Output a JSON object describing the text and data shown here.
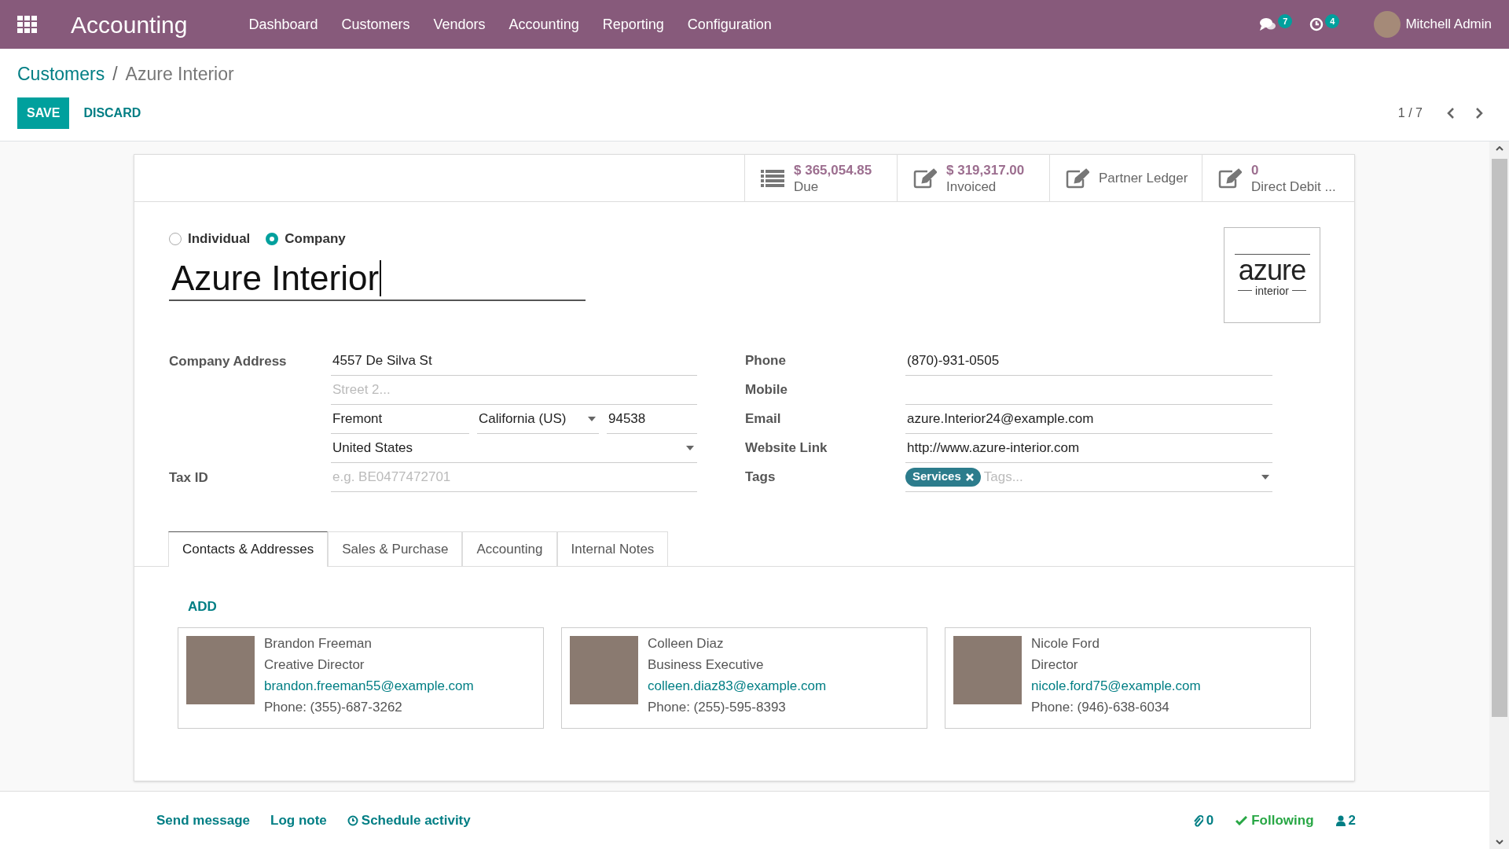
{
  "topbar": {
    "app": "Accounting",
    "menu": [
      "Dashboard",
      "Customers",
      "Vendors",
      "Accounting",
      "Reporting",
      "Configuration"
    ],
    "messages_count": "7",
    "activities_count": "4",
    "user": "Mitchell Admin"
  },
  "breadcrumb": {
    "parent": "Customers",
    "separator": "/",
    "current": "Azure Interior"
  },
  "actions": {
    "save": "SAVE",
    "discard": "DISCARD",
    "pager": "1 / 7"
  },
  "stat_buttons": [
    {
      "kind": "list",
      "value": "$ 365,054.85",
      "label": "Due"
    },
    {
      "kind": "edit",
      "value": "$ 319,317.00",
      "label": "Invoiced"
    },
    {
      "kind": "edit",
      "label": "Partner Ledger"
    },
    {
      "kind": "edit",
      "value": "0",
      "label": "Direct Debit ..."
    }
  ],
  "company_type": [
    {
      "label": "Individual",
      "selected": false
    },
    {
      "label": "Company",
      "selected": true
    }
  ],
  "name": "Azure Interior",
  "logo": {
    "word": "azure",
    "sub": "interior"
  },
  "address": {
    "label": "Company Address",
    "street": "4557 De Silva St",
    "street2_placeholder": "Street 2...",
    "city": "Fremont",
    "state": "California (US)",
    "zip": "94538",
    "country": "United States"
  },
  "tax_id": {
    "label": "Tax ID",
    "placeholder": "e.g. BE0477472701"
  },
  "contact_fields": [
    {
      "label": "Phone",
      "value": "(870)-931-0505"
    },
    {
      "label": "Mobile"
    },
    {
      "label": "Email",
      "value": "azure.Interior24@example.com"
    },
    {
      "label": "Website Link",
      "value": "http://www.azure-interior.com"
    }
  ],
  "tags": {
    "label": "Tags",
    "chips": [
      "Services"
    ],
    "placeholder": "Tags..."
  },
  "tabs": [
    {
      "label": "Contacts & Addresses",
      "selected": true
    },
    {
      "label": "Sales & Purchase",
      "selected": false
    },
    {
      "label": "Accounting",
      "selected": false
    },
    {
      "label": "Internal Notes",
      "selected": false
    }
  ],
  "add": "ADD",
  "contacts": [
    {
      "name": "Brandon Freeman",
      "role": "Creative Director",
      "email": "brandon.freeman55@example.com",
      "phone": "Phone: (355)-687-3262"
    },
    {
      "name": "Colleen Diaz",
      "role": "Business Executive",
      "email": "colleen.diaz83@example.com",
      "phone": "Phone: (255)-595-8393"
    },
    {
      "name": "Nicole Ford",
      "role": "Director",
      "email": "nicole.ford75@example.com",
      "phone": "Phone: (946)-638-6034"
    }
  ],
  "chatter": {
    "send": "Send message",
    "log": "Log note",
    "schedule": "Schedule activity",
    "attachments": "0",
    "following": "Following",
    "followers": "2"
  }
}
